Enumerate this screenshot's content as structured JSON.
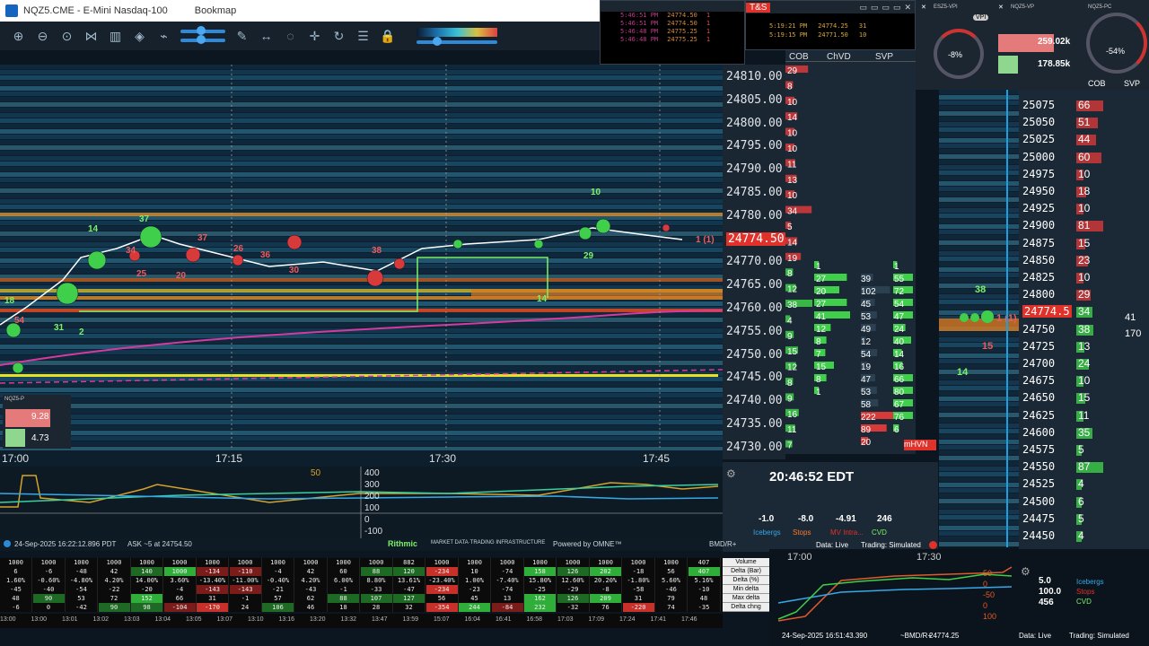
{
  "title": {
    "symbol": "NQZ5.CME - E-Mini Nasdaq-100",
    "app": "Bookmap"
  },
  "toolbar": {
    "icons": [
      "zoom-in-icon",
      "zoom-out-icon",
      "zoom-fit-icon",
      "share-icon",
      "indicators-icon",
      "layers-icon",
      "link-icon",
      "slider-a",
      "slider-b",
      "pencil-icon",
      "measure-icon",
      "chat-icon",
      "crosshair-icon",
      "replay-icon",
      "settings-sliders-icon",
      "lock-icon"
    ]
  },
  "tas_small": {
    "rows": [
      {
        "time": "5:46:51 PM",
        "price": "24774.50",
        "size": "1"
      },
      {
        "time": "5:46:51 PM",
        "price": "24774.50",
        "size": "1"
      },
      {
        "time": "5:46:48 PM",
        "price": "24775.25",
        "size": "1"
      },
      {
        "time": "5:46:48 PM",
        "price": "24775.25",
        "size": "1"
      }
    ]
  },
  "tas_window": {
    "title": "T&S",
    "rows": [
      {
        "time": "5:19:21 PM",
        "price": "24774.25",
        "size": "31"
      },
      {
        "time": "5:19:15 PM",
        "price": "24771.50",
        "size": "10"
      }
    ]
  },
  "columns": [
    "COB",
    "ChVD",
    "SVP"
  ],
  "ladder_prices": [
    "24810.00",
    "24805.00",
    "24800.00",
    "24795.00",
    "24790.00",
    "24785.00",
    "24780.00",
    "24774.50",
    "24770.00",
    "24765.00",
    "24760.00",
    "24755.00",
    "24750.00",
    "24745.00",
    "24740.00",
    "24735.00",
    "24730.00"
  ],
  "ladder_current": "24774.50",
  "time_labels": [
    "17:00",
    "17:15",
    "17:30",
    "17:45"
  ],
  "bubble_labels": [
    {
      "text": "14",
      "color": "green"
    },
    {
      "text": "37",
      "color": "green"
    },
    {
      "text": "34",
      "color": "red"
    },
    {
      "text": "37",
      "color": "red"
    },
    {
      "text": "25",
      "color": "red"
    },
    {
      "text": "10",
      "color": "green"
    },
    {
      "text": "14",
      "color": "green"
    },
    {
      "text": "18",
      "color": "green"
    },
    {
      "text": "54",
      "color": "red"
    },
    {
      "text": "31",
      "color": "green"
    },
    {
      "text": "2",
      "color": "green"
    },
    {
      "text": "29",
      "color": "green"
    },
    {
      "text": "38",
      "color": "red"
    },
    {
      "text": "20",
      "color": "red"
    },
    {
      "text": "26",
      "color": "red"
    },
    {
      "text": "30",
      "color": "red"
    },
    {
      "text": "36",
      "color": "red"
    },
    {
      "text": "1 (1)",
      "color": "red"
    }
  ],
  "mini_widget": {
    "label": "NQZ5-P",
    "upper": "9.28",
    "lower": "4.73"
  },
  "indicator_scale": [
    "50",
    "400",
    "300",
    "200",
    "100",
    "0",
    "-100"
  ],
  "cob_values": [
    "29",
    "8",
    "10",
    "14",
    "10",
    "10",
    "11",
    "13",
    "10",
    "34",
    "5",
    "14",
    "19",
    "8",
    "12",
    "38",
    "4",
    "9",
    "15",
    "12",
    "8",
    "9",
    "16",
    "11",
    "7"
  ],
  "chvd_values": [
    "1",
    "27",
    "20",
    "27",
    "41",
    "12",
    "8",
    "7",
    "15",
    "8",
    "1"
  ],
  "svp_col_a": [
    "39",
    "102",
    "45",
    "53",
    "49",
    "12",
    "54",
    "19",
    "47",
    "53",
    "58",
    "222",
    "89",
    "20"
  ],
  "svp_col_b": [
    "1",
    "55",
    "72",
    "54",
    "47",
    "24",
    "40",
    "14",
    "16",
    "66",
    "80",
    "67",
    "76",
    "6"
  ],
  "mhvn_label": "mHVN",
  "clock": {
    "time": "20:46:52 EDT",
    "values": [
      {
        "value": "-1.0",
        "label": "Icebergs"
      },
      {
        "value": "-8.0",
        "label": "Stops"
      },
      {
        "value": "-4.91",
        "label": "MV Intra..."
      },
      {
        "value": "246",
        "label": "CVD"
      }
    ],
    "data_status": "Data: Live",
    "trading_status": "Trading: Simulated"
  },
  "status": {
    "date": "24-Sep-2025 16:22:12.896 PDT",
    "ask": "ASK ~5 at 24754.50",
    "rithmic": "Rithmic",
    "rithmic_tag": "MARKET DATA·TRADING INFRASTRUCTURE",
    "omne": "Powered by OMNE™",
    "feed": "BMD/R+"
  },
  "widget": {
    "es_label": "ESZ5-VPI",
    "nq_label": "NQZ5-VP",
    "pc_label": "NQZ5-PC",
    "vpi": "VPI",
    "es_pct": "-8%",
    "pc_pct": "-54%",
    "bid_vol": "259.02k",
    "ask_vol": "178.85k",
    "cob": "COB",
    "svp": "SVP"
  },
  "ladder2": {
    "rows": [
      {
        "price": "25075",
        "cnt": "66"
      },
      {
        "price": "25050",
        "cnt": "51"
      },
      {
        "price": "25025",
        "cnt": "44"
      },
      {
        "price": "25000",
        "cnt": "60"
      },
      {
        "price": "24975",
        "cnt": "10"
      },
      {
        "price": "24950",
        "cnt": "18"
      },
      {
        "price": "24925",
        "cnt": "10"
      },
      {
        "price": "24900",
        "cnt": "81"
      },
      {
        "price": "24875",
        "cnt": "15"
      },
      {
        "price": "24850",
        "cnt": "23"
      },
      {
        "price": "24825",
        "cnt": "10"
      },
      {
        "price": "24800",
        "cnt": "29"
      },
      {
        "price": "24774.5",
        "cnt": "34"
      },
      {
        "price": "24750",
        "cnt": "38"
      },
      {
        "price": "24725",
        "cnt": "13"
      },
      {
        "price": "24700",
        "cnt": "24"
      },
      {
        "price": "24675",
        "cnt": "10"
      },
      {
        "price": "24650",
        "cnt": "15"
      },
      {
        "price": "24625",
        "cnt": "11"
      },
      {
        "price": "24600",
        "cnt": "35"
      },
      {
        "price": "24575",
        "cnt": "5"
      },
      {
        "price": "24550",
        "cnt": "87"
      },
      {
        "price": "24525",
        "cnt": "4"
      },
      {
        "price": "24500",
        "cnt": "6"
      },
      {
        "price": "24475",
        "cnt": "5"
      },
      {
        "price": "24450",
        "cnt": "4"
      }
    ],
    "side_a": "41",
    "side_b": "170"
  },
  "mid_labels": [
    {
      "text": "38",
      "color": "green"
    },
    {
      "text": "1 (1)",
      "color": "red"
    },
    {
      "text": "15",
      "color": "red"
    },
    {
      "text": "14",
      "color": "green"
    }
  ],
  "grid": {
    "labels": [
      "Volume",
      "Delta (Bar)",
      "Delta (%)",
      "Min delta",
      "Max delta",
      "Delta chng"
    ],
    "rows": [
      [
        "6",
        "-6",
        "-48",
        "42",
        "140",
        "1000",
        "-134",
        "-110",
        "-4",
        "42",
        "60",
        "88",
        "120",
        "-234",
        "10",
        "-74",
        "158",
        "126",
        "202",
        "-18",
        "56",
        "407"
      ],
      [
        "1.60%",
        "-0.60%",
        "-4.80%",
        "4.20%",
        "14.00%",
        "3.60%",
        "-13.40%",
        "-11.00%",
        "-0.40%",
        "4.20%",
        "6.00%",
        "8.80%",
        "13.61%",
        "-23.40%",
        "1.00%",
        "-7.40%",
        "15.80%",
        "12.60%",
        "20.20%",
        "-1.80%",
        "5.60%",
        "5.16%"
      ],
      [
        "-45",
        "-40",
        "-54",
        "-22",
        "-20",
        "-4",
        "-143",
        "-143",
        "-21",
        "-43",
        "-1",
        "-33",
        "-47",
        "-234",
        "-23",
        "-74",
        "-25",
        "-29",
        "-8",
        "-58",
        "-46",
        "-10"
      ],
      [
        "48",
        "90",
        "53",
        "72",
        "152",
        "66",
        "31",
        "-1",
        "57",
        "62",
        "88",
        "107",
        "127",
        "56",
        "45",
        "13",
        "162",
        "126",
        "209",
        "31",
        "79",
        "48"
      ],
      [
        "-6",
        "0",
        "-42",
        "90",
        "98",
        "-104",
        "-170",
        "24",
        "106",
        "46",
        "18",
        "28",
        "32",
        "-354",
        "244",
        "-84",
        "232",
        "-32",
        "76",
        "-220",
        "74",
        "-35"
      ]
    ],
    "top_row": [
      "1000",
      "1000",
      "1000",
      "1000",
      "1000",
      "1000",
      "1000",
      "1000",
      "1000",
      "1000",
      "1000",
      "1000",
      "882",
      "1000",
      "1000",
      "1000",
      "1000",
      "1000",
      "1000",
      "1000",
      "1000",
      "407"
    ]
  },
  "timeline": [
    "13:00",
    "13:00",
    "13:01",
    "13:02",
    "13:03",
    "13:04",
    "13:05",
    "13:07",
    "13:10",
    "13:16",
    "13:20",
    "13:32",
    "13:47",
    "13:59",
    "15:07",
    "16:04",
    "16:41",
    "16:58",
    "17:03",
    "17:09",
    "17:24",
    "17:41",
    "17:46"
  ],
  "rb": {
    "times": [
      "17:00",
      "17:30"
    ],
    "values": [
      "5.0",
      "100.0",
      "456"
    ],
    "legend": [
      "Icebergs",
      "Stops",
      "CVD"
    ],
    "scale": [
      "50",
      "0",
      "-50",
      "0",
      "100"
    ],
    "date": "24-Sep-2025 16:51:43.390",
    "ask": "~BMD/R+",
    "price": "24774.25",
    "data_status": "Data: Live",
    "trading_status": "Trading: Simulated"
  },
  "colors": {
    "bid_green": "#7cf26a",
    "ask_red": "#f05a5a",
    "bg": "#0d1e2c",
    "magenta": "#d63aa0",
    "yellow": "#e8e020"
  }
}
